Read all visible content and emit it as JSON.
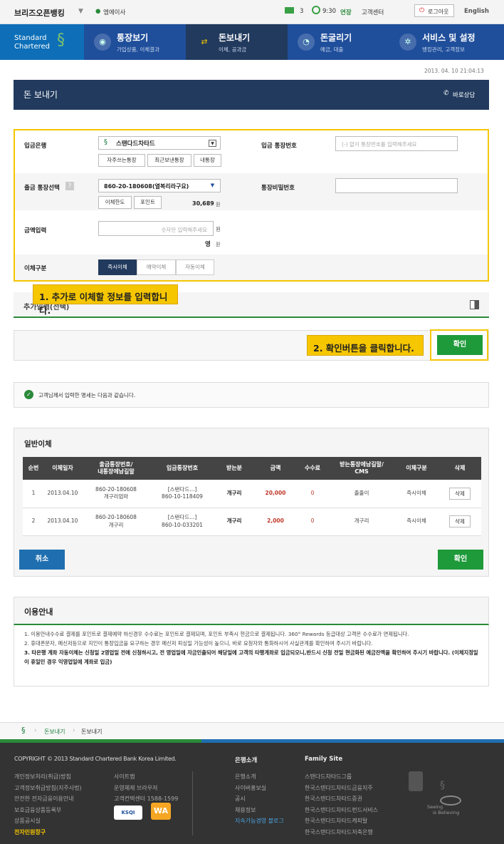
{
  "top": {
    "bank_name": "브리즈오픈뱅킹",
    "user_name": "엠에이사",
    "mail_count": "3",
    "timer": "9:30",
    "extend": "연장",
    "support": "고객센터",
    "logout": "로그아웃",
    "lang": "English"
  },
  "brand": {
    "line1": "Standard",
    "line2": "Chartered"
  },
  "gnb": [
    {
      "title": "통장보기",
      "sub": "가입상품, 이체결과",
      "icon": "eye-icon"
    },
    {
      "title": "돈보내기",
      "sub": "이체, 공과금",
      "icon": "transfer-icon"
    },
    {
      "title": "돈굴리기",
      "sub": "예금, 대출",
      "icon": "coin-icon"
    },
    {
      "title": "서비스 및 설정",
      "sub": "뱅킹관리, 고객정보",
      "icon": "gear-icon"
    }
  ],
  "datetime": "2013. 04. 10 21:04:13",
  "page": {
    "title": "돈 보내기",
    "consult": "바로상담"
  },
  "form": {
    "deposit_bank_label": "입금은행",
    "deposit_bank_value": "스탠다드차타드",
    "bank_btns": [
      "자주쓰는통장",
      "최근보낸통장",
      "내통장"
    ],
    "deposit_account_label": "입금 통장번호",
    "deposit_account_placeholder": "(-) 없이 통장번호를 입력해주세요",
    "out_account_label": "출금 통장선택",
    "out_account_value": "860-20-180608(열복리라구요)",
    "out_btns": [
      "이체한도",
      "포인트"
    ],
    "balance": "30,689",
    "won": "원",
    "password_label": "통장비밀번호",
    "amount_label": "금액입력",
    "amount_placeholder": "숫자만 입력해주세요",
    "amount_korean": "영",
    "type_label": "이체구분",
    "type_tabs": [
      "즉시이체",
      "예약이체",
      "자동이체"
    ]
  },
  "callout1": "1. 추가로 이체할 정보를 입력합니다.",
  "extra_section": "추가입력(선택)",
  "callout2": "2. 확인버튼을 클릭합니다.",
  "confirm_btn": "확인",
  "notice_text": "고객님께서 입력한 명세는 다음과 같습니다.",
  "list": {
    "title": "일반이체",
    "headers": [
      "순번",
      "이체일자",
      "출금통장번호/\n내통장에남길말",
      "입금통장번호",
      "받는분",
      "금액",
      "수수료",
      "받는통장에남길말/\nCMS",
      "이체구분",
      "삭제"
    ],
    "rows": [
      {
        "no": "1",
        "date": "2013.04.10",
        "out1": "860-20-180608",
        "out2": "개구리엄마",
        "in1": "[스탠다드...]",
        "in2": "860-10-118409",
        "recv": "개구리",
        "amount": "20,000",
        "fee": "0",
        "memo": "졸졸이",
        "type": "즉시이체",
        "del": "삭제"
      },
      {
        "no": "2",
        "date": "2013.04.10",
        "out1": "860-20-180608",
        "out2": "개구리",
        "in1": "[스탠다드...]",
        "in2": "860-10-033201",
        "recv": "개구리",
        "amount": "2,000",
        "fee": "0",
        "memo": "개구리",
        "type": "즉시이체",
        "del": "삭제"
      }
    ],
    "cancel": "취소",
    "confirm": "확인"
  },
  "guide": {
    "title": "이용안내",
    "items": [
      "1. 이용안내수수료 결제를 포인트로 결제예약 하신경우 수수료는 포인트로 결제되며, 포인트 부족시 현금으로 결제됩니다. 360° Rewards 등급대상 고객은 수수료가 면제됩니다.",
      "2. 휴대폰문자, 메신저등으로 지인이 통장입금을 요구하는 경우 메신저 피싱일 가능성이 높으니, 바로 요청자와 통화하시어 사실관계를 확인하여 주시기 바랍니다.",
      "3. 타은행 계좌 자동이체는 신청일 2영업일 전에 신청하시고, 전 영업일에 자금인출되어 해당일에 고객의 타행계좌로 입금되오니,반드시 신청 전일 현금화된 예금잔액을 확인하여 주시기 바랍니다. (이체지정일이 휴일인 경우 익영업일에 계좌로 입금)"
    ]
  },
  "breadcrumb": [
    "돈보내기",
    "돈보내기"
  ],
  "footer": {
    "copyright": "COPYRIGHT © 2013 Standard Chartered Bank Korea Limited.",
    "col1": [
      "개인정보처리(취급)방침",
      "고객정보취급방침(지주사법)",
      "안전한 전자금융이용안내",
      "보호금융상품등록부",
      "상품공시실"
    ],
    "col1_bold": "전자민원창구",
    "col2": [
      "사이트맵",
      "운영체제 브라우저",
      "고객컨택센터 1588-1599"
    ],
    "bank_title": "은행소개",
    "bank_links": [
      "은행소개",
      "사이버홍보실",
      "공시",
      "채용정보"
    ],
    "bank_special": "지속가능경영 블로그",
    "family_title": "Family Site",
    "family_links": [
      "스탠다드차타드그룹",
      "한국스탠다드차타드금융지주",
      "한국스탠다드차타드증권",
      "한국스탠다드차타드펀드서비스",
      "한국스탠다드차타드캐피탈",
      "한국스탠다드차타드저축은행"
    ],
    "badge1": "KSQI",
    "badge2": "WA",
    "slogan1": "Seeing",
    "slogan2": "is Believing"
  },
  "colors": {
    "navy": "#1f4e9b",
    "header_dark": "#213a5e",
    "green": "#1e9a3a",
    "yellow": "#f6c600",
    "red": "#c0392b"
  }
}
